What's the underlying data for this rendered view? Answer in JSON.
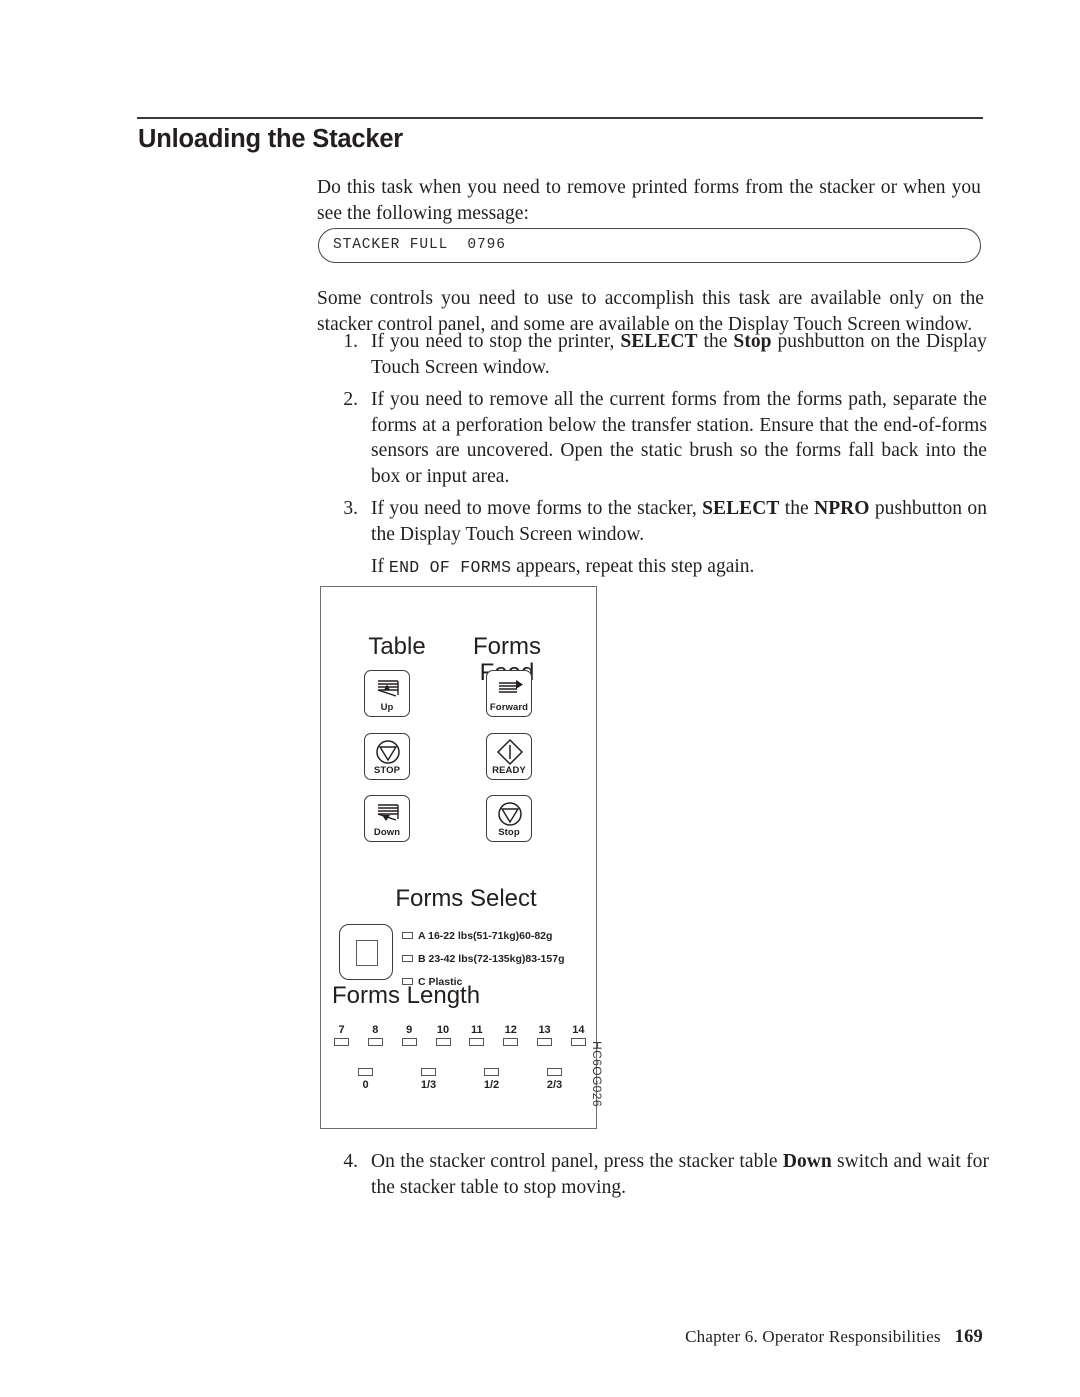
{
  "page": {
    "title": "Unloading the Stacker",
    "footer_chapter": "Chapter 6. Operator Responsibilities",
    "footer_page": "169"
  },
  "intro": {
    "paragraph": "Do this task when you need to remove printed forms from the stacker or when you see the following message:",
    "message_box": "STACKER FULL  0796",
    "paragraph2": "Some controls you need to use to accomplish this task are available only on the stacker control panel, and some are available on the Display Touch Screen window."
  },
  "steps": [
    {
      "num": "1.",
      "parts": [
        {
          "t": "If you need to stop the printer, ",
          "b": false
        },
        {
          "t": "SELECT",
          "b": true
        },
        {
          "t": " the ",
          "b": false
        },
        {
          "t": "Stop",
          "b": true
        },
        {
          "t": " pushbutton on the Display Touch Screen window.",
          "b": false
        }
      ]
    },
    {
      "num": "2.",
      "parts": [
        {
          "t": "If you need to remove all the current forms from the forms path, separate the forms at a perforation below the transfer station. Ensure that the end-of-forms sensors are uncovered. Open the static brush so the forms fall back into the box or input area.",
          "b": false
        }
      ]
    },
    {
      "num": "3.",
      "parts": [
        {
          "t": "If you need to move forms to the stacker, ",
          "b": false
        },
        {
          "t": "SELECT",
          "b": true
        },
        {
          "t": " the ",
          "b": false
        },
        {
          "t": "NPRO",
          "b": true
        },
        {
          "t": " pushbutton on the Display Touch Screen window.",
          "b": false
        }
      ],
      "sub": [
        {
          "t": "If ",
          "b": false,
          "m": false
        },
        {
          "t": "END OF FORMS",
          "b": false,
          "m": true
        },
        {
          "t": " appears, repeat this step again.",
          "b": false,
          "m": false
        }
      ]
    }
  ],
  "step4": {
    "num": "4.",
    "parts": [
      {
        "t": "On the stacker control panel, press the stacker table ",
        "b": false
      },
      {
        "t": "Down",
        "b": true
      },
      {
        "t": " switch and wait for the stacker table to stop moving.",
        "b": false
      }
    ]
  },
  "figure": {
    "id_label": "HC6OG026",
    "group_table": "Table",
    "group_forms_feed": "Forms\nFeed",
    "forms_select_title": "Forms Select",
    "forms_length_title": "Forms Length",
    "buttons": [
      {
        "caption": "Up",
        "icon": "forms-stack-up-icon"
      },
      {
        "caption": "STOP",
        "icon": "stop-circle-triangle-icon"
      },
      {
        "caption": "Down",
        "icon": "forms-stack-down-icon"
      },
      {
        "caption": "Forward",
        "icon": "forms-feed-forward-icon"
      },
      {
        "caption": "READY",
        "icon": "ready-diamond-icon"
      },
      {
        "caption": "Stop",
        "icon": "stop-circle-triangle-icon"
      }
    ],
    "forms_select_options": [
      "A 16-22 lbs(51-71kg)60-82g",
      "B 23-42 lbs(72-135kg)83-157g",
      "C Plastic"
    ],
    "forms_length_top": [
      "7",
      "8",
      "9",
      "10",
      "11",
      "12",
      "13",
      "14"
    ],
    "forms_length_bottom": [
      "0",
      "1/3",
      "1/2",
      "2/3"
    ]
  }
}
